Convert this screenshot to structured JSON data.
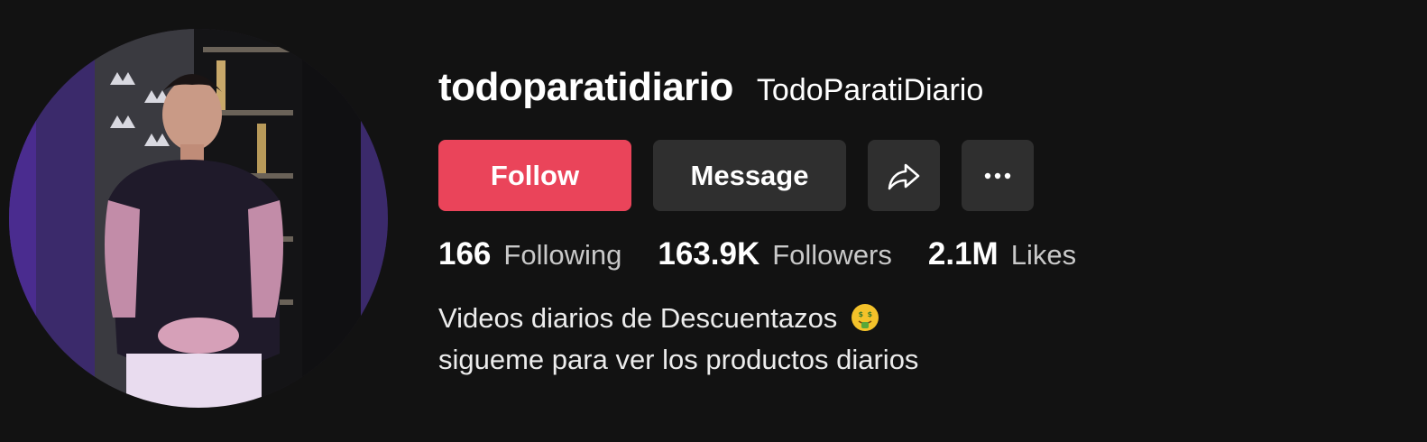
{
  "profile": {
    "username": "todoparatidiario",
    "display_name": "TodoParatiDiario",
    "avatar_icon": "profile-photo"
  },
  "actions": {
    "follow_label": "Follow",
    "message_label": "Message",
    "share_icon": "share-arrow-icon",
    "more_icon": "more-dots-icon"
  },
  "stats": [
    {
      "value": "166",
      "label": "Following"
    },
    {
      "value": "163.9K",
      "label": "Followers"
    },
    {
      "value": "2.1M",
      "label": "Likes"
    }
  ],
  "bio": {
    "line1": "Videos diarios de Descuentazos",
    "line1_emoji": "money-mouth-face-icon",
    "line2": "sigueme para ver los productos diarios"
  },
  "colors": {
    "background": "#121212",
    "follow_button": "#ea445a",
    "secondary_button": "#2f2f2f",
    "stat_label": "#c9c9c9"
  }
}
